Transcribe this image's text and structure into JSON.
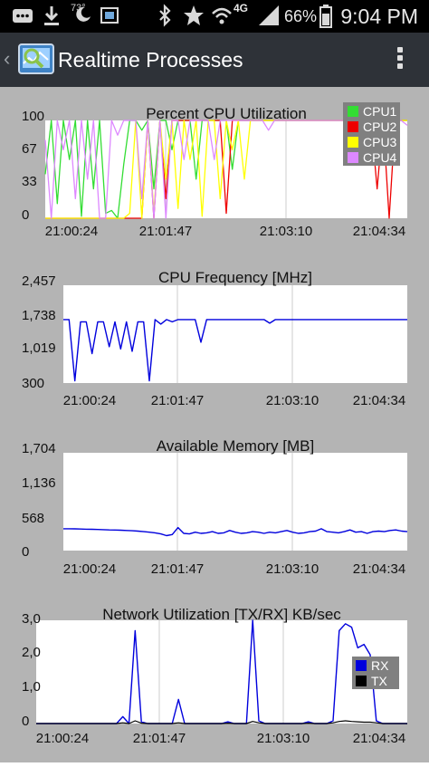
{
  "status_bar": {
    "weather_temp": "73°",
    "network_type": "4G",
    "battery_percent": "66%",
    "time": "9:04 PM",
    "icons": [
      "chat-icon",
      "download-icon",
      "weather-icon",
      "screen-icon",
      "bluetooth-icon",
      "star-icon",
      "wifi-icon",
      "signal-icon",
      "battery-icon"
    ]
  },
  "action_bar": {
    "title": "Realtime Processes",
    "icons": [
      "back-chevron-icon",
      "app-icon",
      "overflow-menu-icon"
    ]
  },
  "colors": {
    "cpu1": "#33dd33",
    "cpu2": "#ee0000",
    "cpu3": "#ffff00",
    "cpu4": "#dd88ff",
    "rx": "#0000dd",
    "tx": "#000000",
    "plot_bg": "#ffffff",
    "panel_bg": "#b4b4b4"
  },
  "chart_data": [
    {
      "type": "line",
      "title": "Percent CPU Utilization",
      "y_ticks": [
        "100",
        "67",
        "33",
        "0"
      ],
      "x_ticks": [
        "21:00:24",
        "21:01:47",
        "21:03:10",
        "21:04:34"
      ],
      "ylim": [
        0,
        100
      ],
      "legend": "top-right",
      "grid": true,
      "series": [
        {
          "name": "CPU1",
          "values": [
            45,
            100,
            15,
            100,
            60,
            100,
            2,
            100,
            30,
            100,
            5,
            8,
            0,
            55,
            100,
            100,
            90,
            100,
            30,
            100,
            100,
            70,
            100,
            100,
            100,
            40,
            100,
            100,
            100,
            100,
            100,
            50,
            100,
            100,
            100,
            100,
            100,
            100,
            100,
            100,
            100,
            100,
            100,
            100,
            100,
            100,
            100,
            100,
            100,
            100,
            100,
            100,
            100,
            100,
            100,
            95,
            100,
            100,
            100,
            100,
            100
          ]
        },
        {
          "name": "CPU2",
          "values": [
            0,
            0,
            0,
            0,
            0,
            0,
            0,
            0,
            0,
            0,
            0,
            0,
            0,
            0,
            0,
            0,
            0,
            100,
            0,
            100,
            20,
            100,
            100,
            100,
            100,
            100,
            100,
            100,
            100,
            100,
            5,
            100,
            100,
            100,
            100,
            100,
            100,
            100,
            100,
            100,
            100,
            100,
            100,
            100,
            100,
            100,
            100,
            100,
            100,
            100,
            100,
            100,
            100,
            100,
            100,
            30,
            100,
            0,
            100,
            100,
            100
          ]
        },
        {
          "name": "CPU3",
          "values": [
            0,
            0,
            0,
            0,
            0,
            0,
            0,
            0,
            0,
            0,
            0,
            0,
            0,
            0,
            5,
            100,
            0,
            100,
            5,
            100,
            40,
            100,
            10,
            100,
            60,
            100,
            2,
            100,
            100,
            20,
            100,
            70,
            100,
            40,
            100,
            100,
            100,
            100,
            100,
            100,
            100,
            100,
            100,
            100,
            100,
            100,
            100,
            100,
            100,
            100,
            100,
            100,
            100,
            100,
            100,
            100,
            100,
            100,
            100,
            100,
            100
          ]
        },
        {
          "name": "CPU4",
          "values": [
            80,
            0,
            100,
            70,
            100,
            20,
            100,
            40,
            100,
            0,
            0,
            100,
            85,
            100,
            100,
            100,
            20,
            100,
            0,
            100,
            0,
            100,
            100,
            60,
            100,
            100,
            100,
            100,
            60,
            100,
            100,
            100,
            100,
            100,
            100,
            100,
            100,
            90,
            100,
            100,
            100,
            100,
            100,
            100,
            100,
            100,
            100,
            100,
            100,
            100,
            100,
            100,
            100,
            100,
            100,
            100,
            100,
            100,
            100,
            100,
            95
          ]
        }
      ]
    },
    {
      "type": "line",
      "title": "CPU Frequency [MHz]",
      "y_ticks": [
        "2,457",
        "1,738",
        "1,019",
        "300"
      ],
      "x_ticks": [
        "21:00:24",
        "21:01:47",
        "21:03:10",
        "21:04:34"
      ],
      "ylim": [
        300,
        2457
      ],
      "grid": true,
      "series": [
        {
          "name": "CPU Frequency",
          "values": [
            1700,
            1700,
            350,
            1650,
            1650,
            950,
            1650,
            1650,
            1100,
            1650,
            1050,
            1650,
            1000,
            1650,
            1650,
            350,
            1700,
            1600,
            1700,
            1650,
            1700,
            1700,
            1700,
            1700,
            1200,
            1700,
            1700,
            1700,
            1700,
            1700,
            1700,
            1700,
            1700,
            1700,
            1700,
            1700,
            1620,
            1700,
            1700,
            1700,
            1700,
            1700,
            1700,
            1700,
            1700,
            1700,
            1700,
            1700,
            1700,
            1700,
            1700,
            1700,
            1700,
            1700,
            1700,
            1700,
            1700,
            1700,
            1700,
            1700,
            1700
          ]
        }
      ]
    },
    {
      "type": "line",
      "title": "Available Memory [MB]",
      "y_ticks": [
        "1,704",
        "1,136",
        "568",
        "0"
      ],
      "x_ticks": [
        "21:00:24",
        "21:01:47",
        "21:03:10",
        "21:04:34"
      ],
      "ylim": [
        0,
        1704
      ],
      "grid": true,
      "series": [
        {
          "name": "Available Memory",
          "values": [
            380,
            380,
            378,
            375,
            372,
            370,
            368,
            365,
            360,
            358,
            355,
            350,
            345,
            340,
            330,
            320,
            310,
            290,
            260,
            280,
            400,
            300,
            290,
            320,
            300,
            310,
            330,
            300,
            310,
            350,
            320,
            300,
            310,
            330,
            320,
            300,
            320,
            310,
            330,
            350,
            320,
            300,
            310,
            330,
            340,
            380,
            330,
            320,
            310,
            330,
            360,
            320,
            330,
            300,
            330,
            340,
            330,
            350,
            360,
            340,
            330
          ]
        }
      ]
    },
    {
      "type": "line",
      "title": "Network Utilization [TX/RX] KB/sec",
      "y_ticks": [
        "3,0",
        "2,0",
        "1,0",
        "0"
      ],
      "x_ticks": [
        "21:00:24",
        "21:01:47",
        "21:03:10",
        "21:04:34"
      ],
      "ylim": [
        0,
        3000
      ],
      "legend": "right",
      "grid": true,
      "series": [
        {
          "name": "RX",
          "values": [
            0,
            0,
            0,
            0,
            0,
            0,
            0,
            0,
            0,
            0,
            0,
            0,
            0,
            0,
            200,
            0,
            2700,
            50,
            0,
            0,
            0,
            0,
            0,
            700,
            0,
            0,
            0,
            0,
            0,
            0,
            0,
            50,
            0,
            0,
            0,
            3000,
            80,
            0,
            0,
            0,
            0,
            0,
            0,
            0,
            50,
            0,
            0,
            0,
            80,
            2700,
            2900,
            2800,
            2200,
            2300,
            2000,
            80,
            0,
            0,
            0,
            0,
            0
          ]
        },
        {
          "name": "TX",
          "values": [
            0,
            0,
            0,
            0,
            0,
            0,
            0,
            0,
            0,
            0,
            0,
            0,
            0,
            0,
            20,
            0,
            80,
            10,
            0,
            0,
            0,
            0,
            0,
            20,
            0,
            0,
            0,
            0,
            0,
            0,
            0,
            10,
            0,
            0,
            0,
            60,
            20,
            0,
            0,
            0,
            0,
            0,
            0,
            0,
            10,
            0,
            0,
            0,
            20,
            60,
            80,
            60,
            50,
            40,
            40,
            20,
            0,
            0,
            0,
            0,
            0
          ]
        }
      ]
    }
  ]
}
